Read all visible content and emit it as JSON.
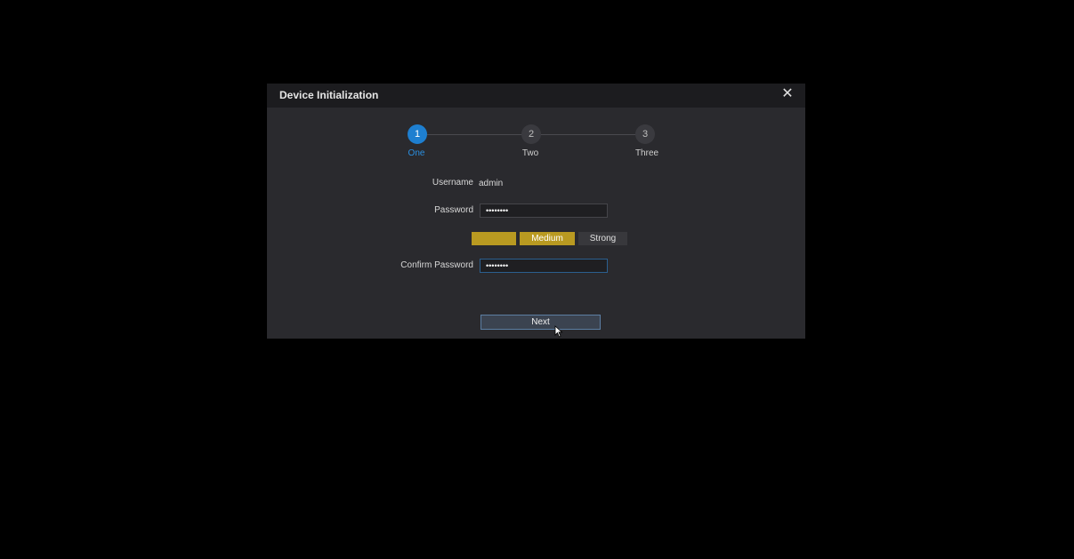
{
  "dialog": {
    "title": "Device Initialization",
    "close_icon": "close-icon"
  },
  "steps": [
    {
      "number": "1",
      "label": "One",
      "active": true
    },
    {
      "number": "2",
      "label": "Two",
      "active": false
    },
    {
      "number": "3",
      "label": "Three",
      "active": false
    }
  ],
  "form": {
    "username_label": "Username",
    "username_value": "admin",
    "password_label": "Password",
    "password_value": "••••••••",
    "strength_weak_label": "",
    "strength_medium_label": "Medium",
    "strength_strong_label": "Strong",
    "confirm_label": "Confirm Password",
    "confirm_value": "••••••••"
  },
  "actions": {
    "next_label": "Next"
  },
  "colors": {
    "accent": "#1e7fd0",
    "strength_active": "#b99a21",
    "strength_inactive": "#38383c"
  }
}
